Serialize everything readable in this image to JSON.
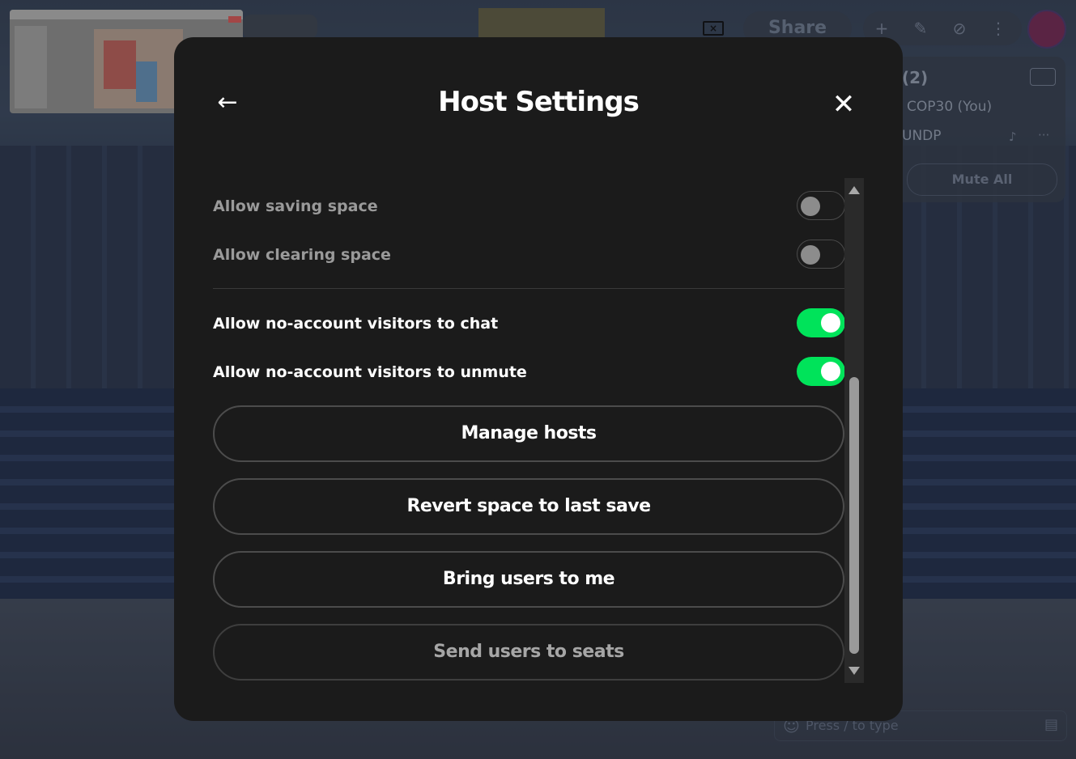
{
  "background": {
    "share_label": "Share",
    "participants": {
      "count_label": "(2)",
      "self_label": "COP30 (You)",
      "other_label": "UNDP",
      "mute_all_label": "Mute All"
    },
    "chat": {
      "placeholder": "Press / to type"
    }
  },
  "modal": {
    "title": "Host Settings",
    "toggles": [
      {
        "label": "Allow saving space",
        "state": "off",
        "enabled": false
      },
      {
        "label": "Allow clearing space",
        "state": "off",
        "enabled": false
      },
      {
        "label": "Allow no-account visitors to chat",
        "state": "on",
        "enabled": true
      },
      {
        "label": "Allow no-account visitors to unmute",
        "state": "on",
        "enabled": true
      }
    ],
    "buttons": [
      {
        "label": "Manage hosts",
        "enabled": true
      },
      {
        "label": "Revert space to last save",
        "enabled": true
      },
      {
        "label": "Bring users to me",
        "enabled": true
      },
      {
        "label": "Send users to seats",
        "enabled": false
      }
    ]
  },
  "colors": {
    "modal_bg": "#1b1b1b",
    "toggle_on": "#00e35a",
    "text_primary": "#ffffff",
    "text_disabled": "#9a9a9a"
  },
  "icons": {
    "back": "arrow-left-icon",
    "close": "close-icon",
    "scroll_up": "scroll-up-arrow",
    "scroll_down": "scroll-down-arrow"
  }
}
